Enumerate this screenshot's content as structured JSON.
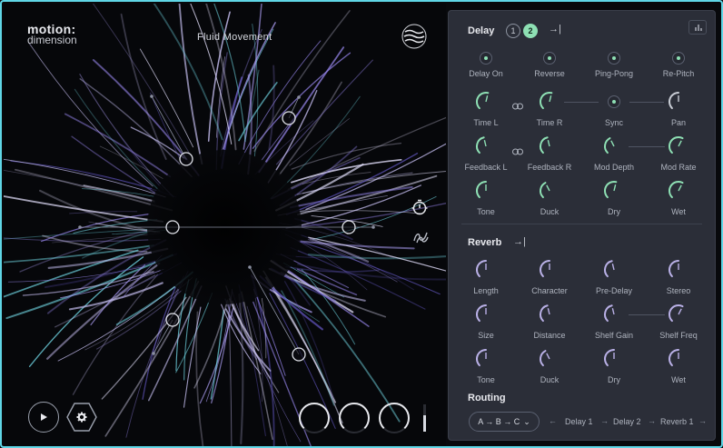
{
  "app": {
    "logo_line1": "motion:",
    "logo_line2": "dimension",
    "preset_name": "Fluid Movement"
  },
  "transport": {
    "play_icon": "play-icon",
    "settings_icon": "gear-icon"
  },
  "delay": {
    "title": "Delay",
    "tab1": "1",
    "tab2": "2",
    "switches": [
      "Delay On",
      "Reverse",
      "Ping-Pong",
      "Re-Pitch"
    ],
    "row2": [
      "Time L",
      "Time R",
      "Sync",
      "Pan"
    ],
    "row3": [
      "Feedback L",
      "Feedback R",
      "Mod Depth",
      "Mod Rate"
    ],
    "row4": [
      "Tone",
      "Duck",
      "Dry",
      "Wet"
    ]
  },
  "reverb": {
    "title": "Reverb",
    "row1": [
      "Length",
      "Character",
      "Pre-Delay",
      "Stereo"
    ],
    "row2": [
      "Size",
      "Distance",
      "Shelf Gain",
      "Shelf Freq"
    ],
    "row3": [
      "Tone",
      "Duck",
      "Dry",
      "Wet"
    ]
  },
  "routing": {
    "title": "Routing",
    "selected": "A → B → C",
    "chain": [
      "Delay 1",
      "Delay 2",
      "Reverb 1"
    ]
  },
  "colors": {
    "accent_cyan": "#5fd6e6",
    "accent_green": "#8ee0b4",
    "panel_bg": "#2b2e38",
    "knob_arc": "#b9b0e6"
  }
}
